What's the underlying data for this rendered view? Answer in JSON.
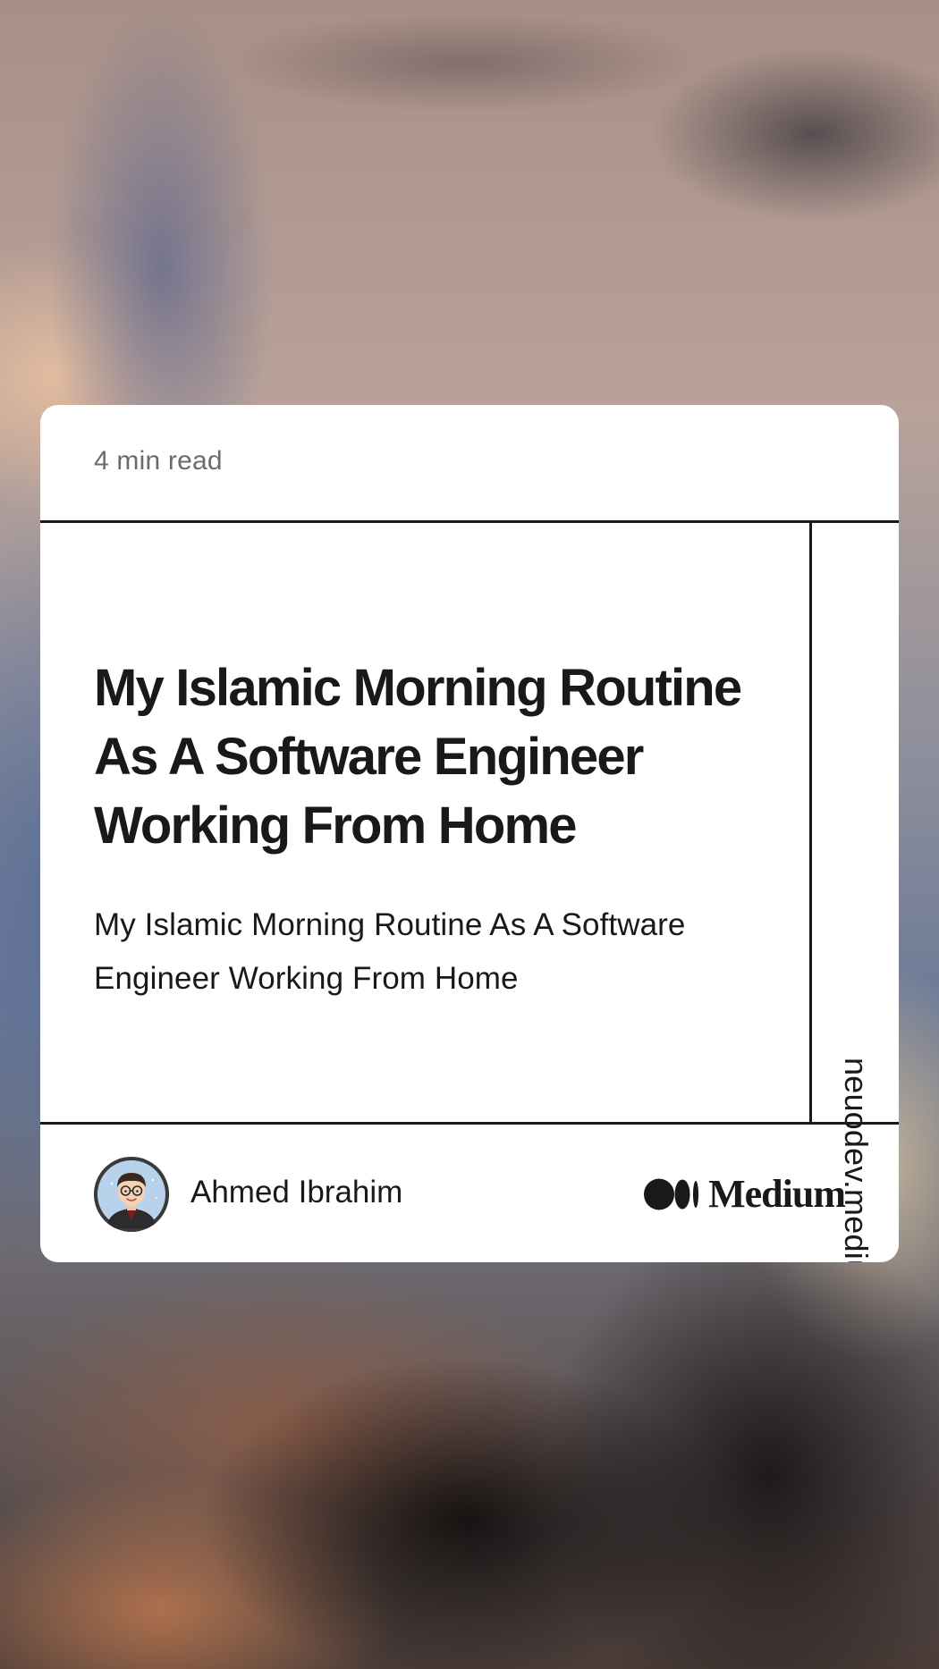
{
  "card": {
    "read_time": "4 min read",
    "title": "My Islamic Morning Routine As A Software Engineer Working From Home",
    "subtitle": "My Islamic Morning Routine As A Software Engineer Working From Home",
    "side_domain": "neuodev.medium.com",
    "author": {
      "name": "Ahmed Ibrahim",
      "avatar_icon": "avatar-illustration"
    },
    "brand": {
      "name": "Medium",
      "logo_icon": "medium-logo-icon"
    }
  },
  "colors": {
    "text": "#191919",
    "muted": "#6b6b6b",
    "card_bg": "#ffffff",
    "divider": "#191919"
  }
}
